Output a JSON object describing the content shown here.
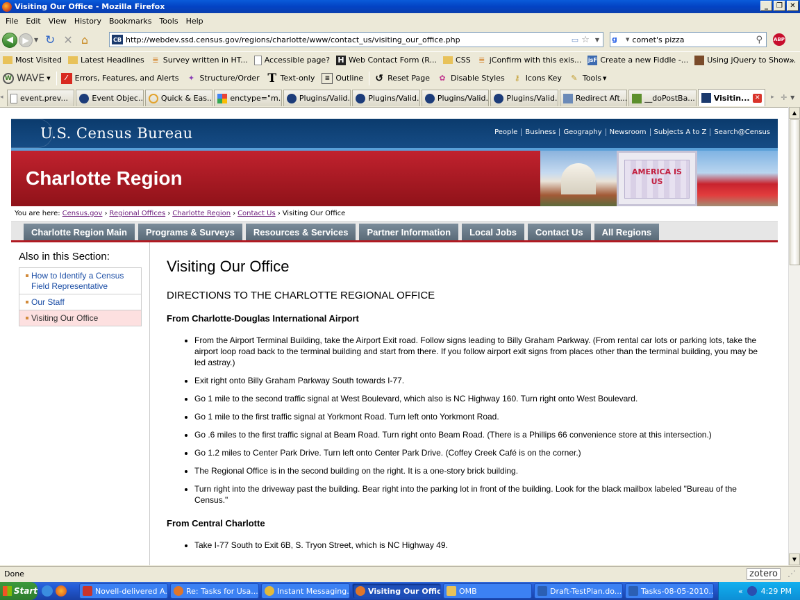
{
  "window": {
    "title": "Visiting Our Office - Mozilla Firefox"
  },
  "menu": [
    "File",
    "Edit",
    "View",
    "History",
    "Bookmarks",
    "Tools",
    "Help"
  ],
  "nav": {
    "url": "http://webdev.ssd.census.gov/regions/charlotte/www/contact_us/visiting_our_office.php",
    "search_value": "comet's pizza",
    "site_badge": "CB",
    "abp_label": "ABP"
  },
  "bookmarks": [
    "Most Visited",
    "Latest Headlines",
    "Survey written in HT...",
    "Accessible page?",
    "Web Contact Form (R...",
    "CSS",
    "jConfirm with this exis...",
    "Create a new Fiddle -...",
    "Using jQuery to Show..."
  ],
  "wave_toolbar": {
    "brand": "WAVE",
    "items": [
      "Errors, Features, and Alerts",
      "Structure/Order",
      "Text-only",
      "Outline",
      "Reset Page",
      "Disable Styles",
      "Icons Key",
      "Tools"
    ]
  },
  "tabs": [
    "event.prev...",
    "Event Objec...",
    "Quick & Eas...",
    "enctype=\"m...",
    "Plugins/Valid...",
    "Plugins/Valid...",
    "Plugins/Valid...",
    "Plugins/Valid...",
    "Redirect Aft...",
    "__doPostBa...",
    "Visitin..."
  ],
  "site": {
    "brand": "U.S. Census Bureau",
    "top_links": [
      "People",
      "Business",
      "Geography",
      "Newsroom",
      "Subjects A to Z",
      "Search@Census"
    ],
    "region_title": "Charlotte Region",
    "photo_sign": "AMERICA IS US",
    "breadcrumb": {
      "prefix": "You are here:",
      "links": [
        "Census.gov",
        "Regional Offices",
        "Charlotte Region",
        "Contact Us"
      ],
      "current": "Visiting Our Office"
    },
    "nav_tabs": [
      "Charlotte Region Main",
      "Programs & Surveys",
      "Resources & Services",
      "Partner Information",
      "Local Jobs",
      "Contact Us",
      "All Regions"
    ],
    "sidebar": {
      "heading": "Also in this Section:",
      "items": [
        "How to Identify a Census Field Representative",
        "Our Staff",
        "Visiting Our Office"
      ]
    },
    "main": {
      "title": "Visiting Our Office",
      "subtitle": "DIRECTIONS TO THE CHARLOTTE REGIONAL OFFICE",
      "section1": {
        "heading": "From Charlotte-Douglas International Airport",
        "steps": [
          "From the Airport Terminal Building, take the Airport Exit road. Follow signs leading to Billy Graham Parkway. (From rental car lots or parking lots, take the airport loop road back to the terminal building and start from there. If you follow airport exit signs from places other than the terminal building, you may be led astray.)",
          "Exit right onto Billy Graham Parkway South towards I-77.",
          "Go 1 mile to the second traffic signal at West Boulevard, which also is NC Highway 160. Turn right onto West Boulevard.",
          "Go 1 mile to the first traffic signal at Yorkmont Road. Turn left onto Yorkmont Road.",
          "Go .6 miles to the first traffic signal at Beam Road. Turn right onto Beam Road. (There is a Phillips 66 convenience store at this intersection.)",
          "Go 1.2 miles to Center Park Drive. Turn left onto Center Park Drive. (Coffey Creek Café is on the corner.)",
          "The Regional Office is in the second building on the right. It is a one-story brick building.",
          "Turn right into the driveway past the building. Bear right into the parking lot in front of the building. Look for the black mailbox labeled \"Bureau of the Census.\""
        ]
      },
      "section2": {
        "heading": "From Central Charlotte",
        "steps": [
          "Take I-77 South to Exit 6B, S. Tryon Street, which is NC Highway 49."
        ]
      }
    }
  },
  "status": {
    "text": "Done",
    "zotero": "zotero"
  },
  "taskbar": {
    "start": "Start",
    "tasks": [
      "Novell-delivered A...",
      "Re: Tasks for Usa...",
      "Instant Messaging...",
      "Visiting Our Offic...",
      "OMB",
      "Draft-TestPlan.do...",
      "Tasks-08-05-2010...."
    ],
    "clock": "4:29 PM"
  }
}
